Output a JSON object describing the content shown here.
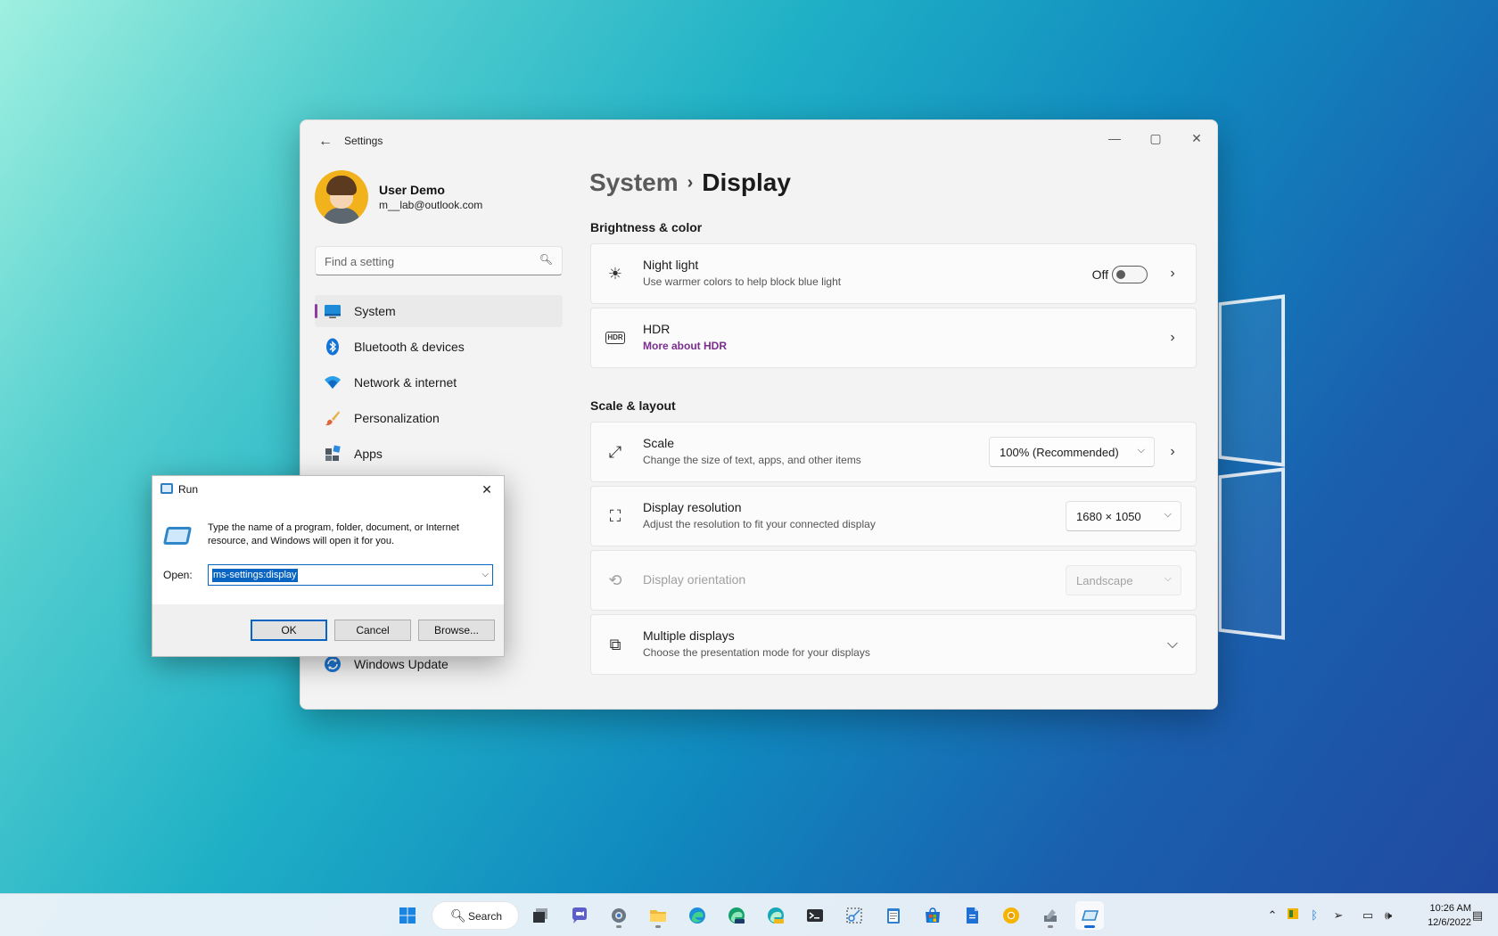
{
  "settings": {
    "window_title": "Settings",
    "user": {
      "name": "User Demo",
      "email": "m__lab@outlook.com"
    },
    "search_placeholder": "Find a setting",
    "nav": [
      {
        "label": "System",
        "icon": "monitor-icon",
        "active": true
      },
      {
        "label": "Bluetooth & devices",
        "icon": "bluetooth-icon"
      },
      {
        "label": "Network & internet",
        "icon": "wifi-icon"
      },
      {
        "label": "Personalization",
        "icon": "brush-icon"
      },
      {
        "label": "Apps",
        "icon": "apps-icon"
      }
    ],
    "nav_update": {
      "label": "Windows Update",
      "icon": "update-icon"
    },
    "breadcrumb": {
      "parent": "System",
      "separator": "›",
      "current": "Display"
    },
    "sections": {
      "brightness": "Brightness & color",
      "scale_layout": "Scale & layout"
    },
    "cards": {
      "night_light": {
        "title": "Night light",
        "subtitle": "Use warmer colors to help block blue light",
        "toggle_label": "Off",
        "toggle_on": false
      },
      "hdr": {
        "title": "HDR",
        "link": "More about HDR"
      },
      "scale": {
        "title": "Scale",
        "subtitle": "Change the size of text, apps, and other items",
        "value": "100% (Recommended)"
      },
      "resolution": {
        "title": "Display resolution",
        "subtitle": "Adjust the resolution to fit your connected display",
        "value": "1680 × 1050"
      },
      "orientation": {
        "title": "Display orientation",
        "value": "Landscape",
        "disabled": true
      },
      "multiple": {
        "title": "Multiple displays",
        "subtitle": "Choose the presentation mode for your displays"
      }
    },
    "accent_color": "#8e3ca3"
  },
  "run_dialog": {
    "title": "Run",
    "description": "Type the name of a program, folder, document, or Internet resource, and Windows will open it for you.",
    "open_label": "Open:",
    "open_value": "ms-settings:display",
    "buttons": {
      "ok": "OK",
      "cancel": "Cancel",
      "browse": "Browse..."
    }
  },
  "taskbar": {
    "search_label": "Search",
    "time": "10:26 AM",
    "date": "12/6/2022"
  }
}
